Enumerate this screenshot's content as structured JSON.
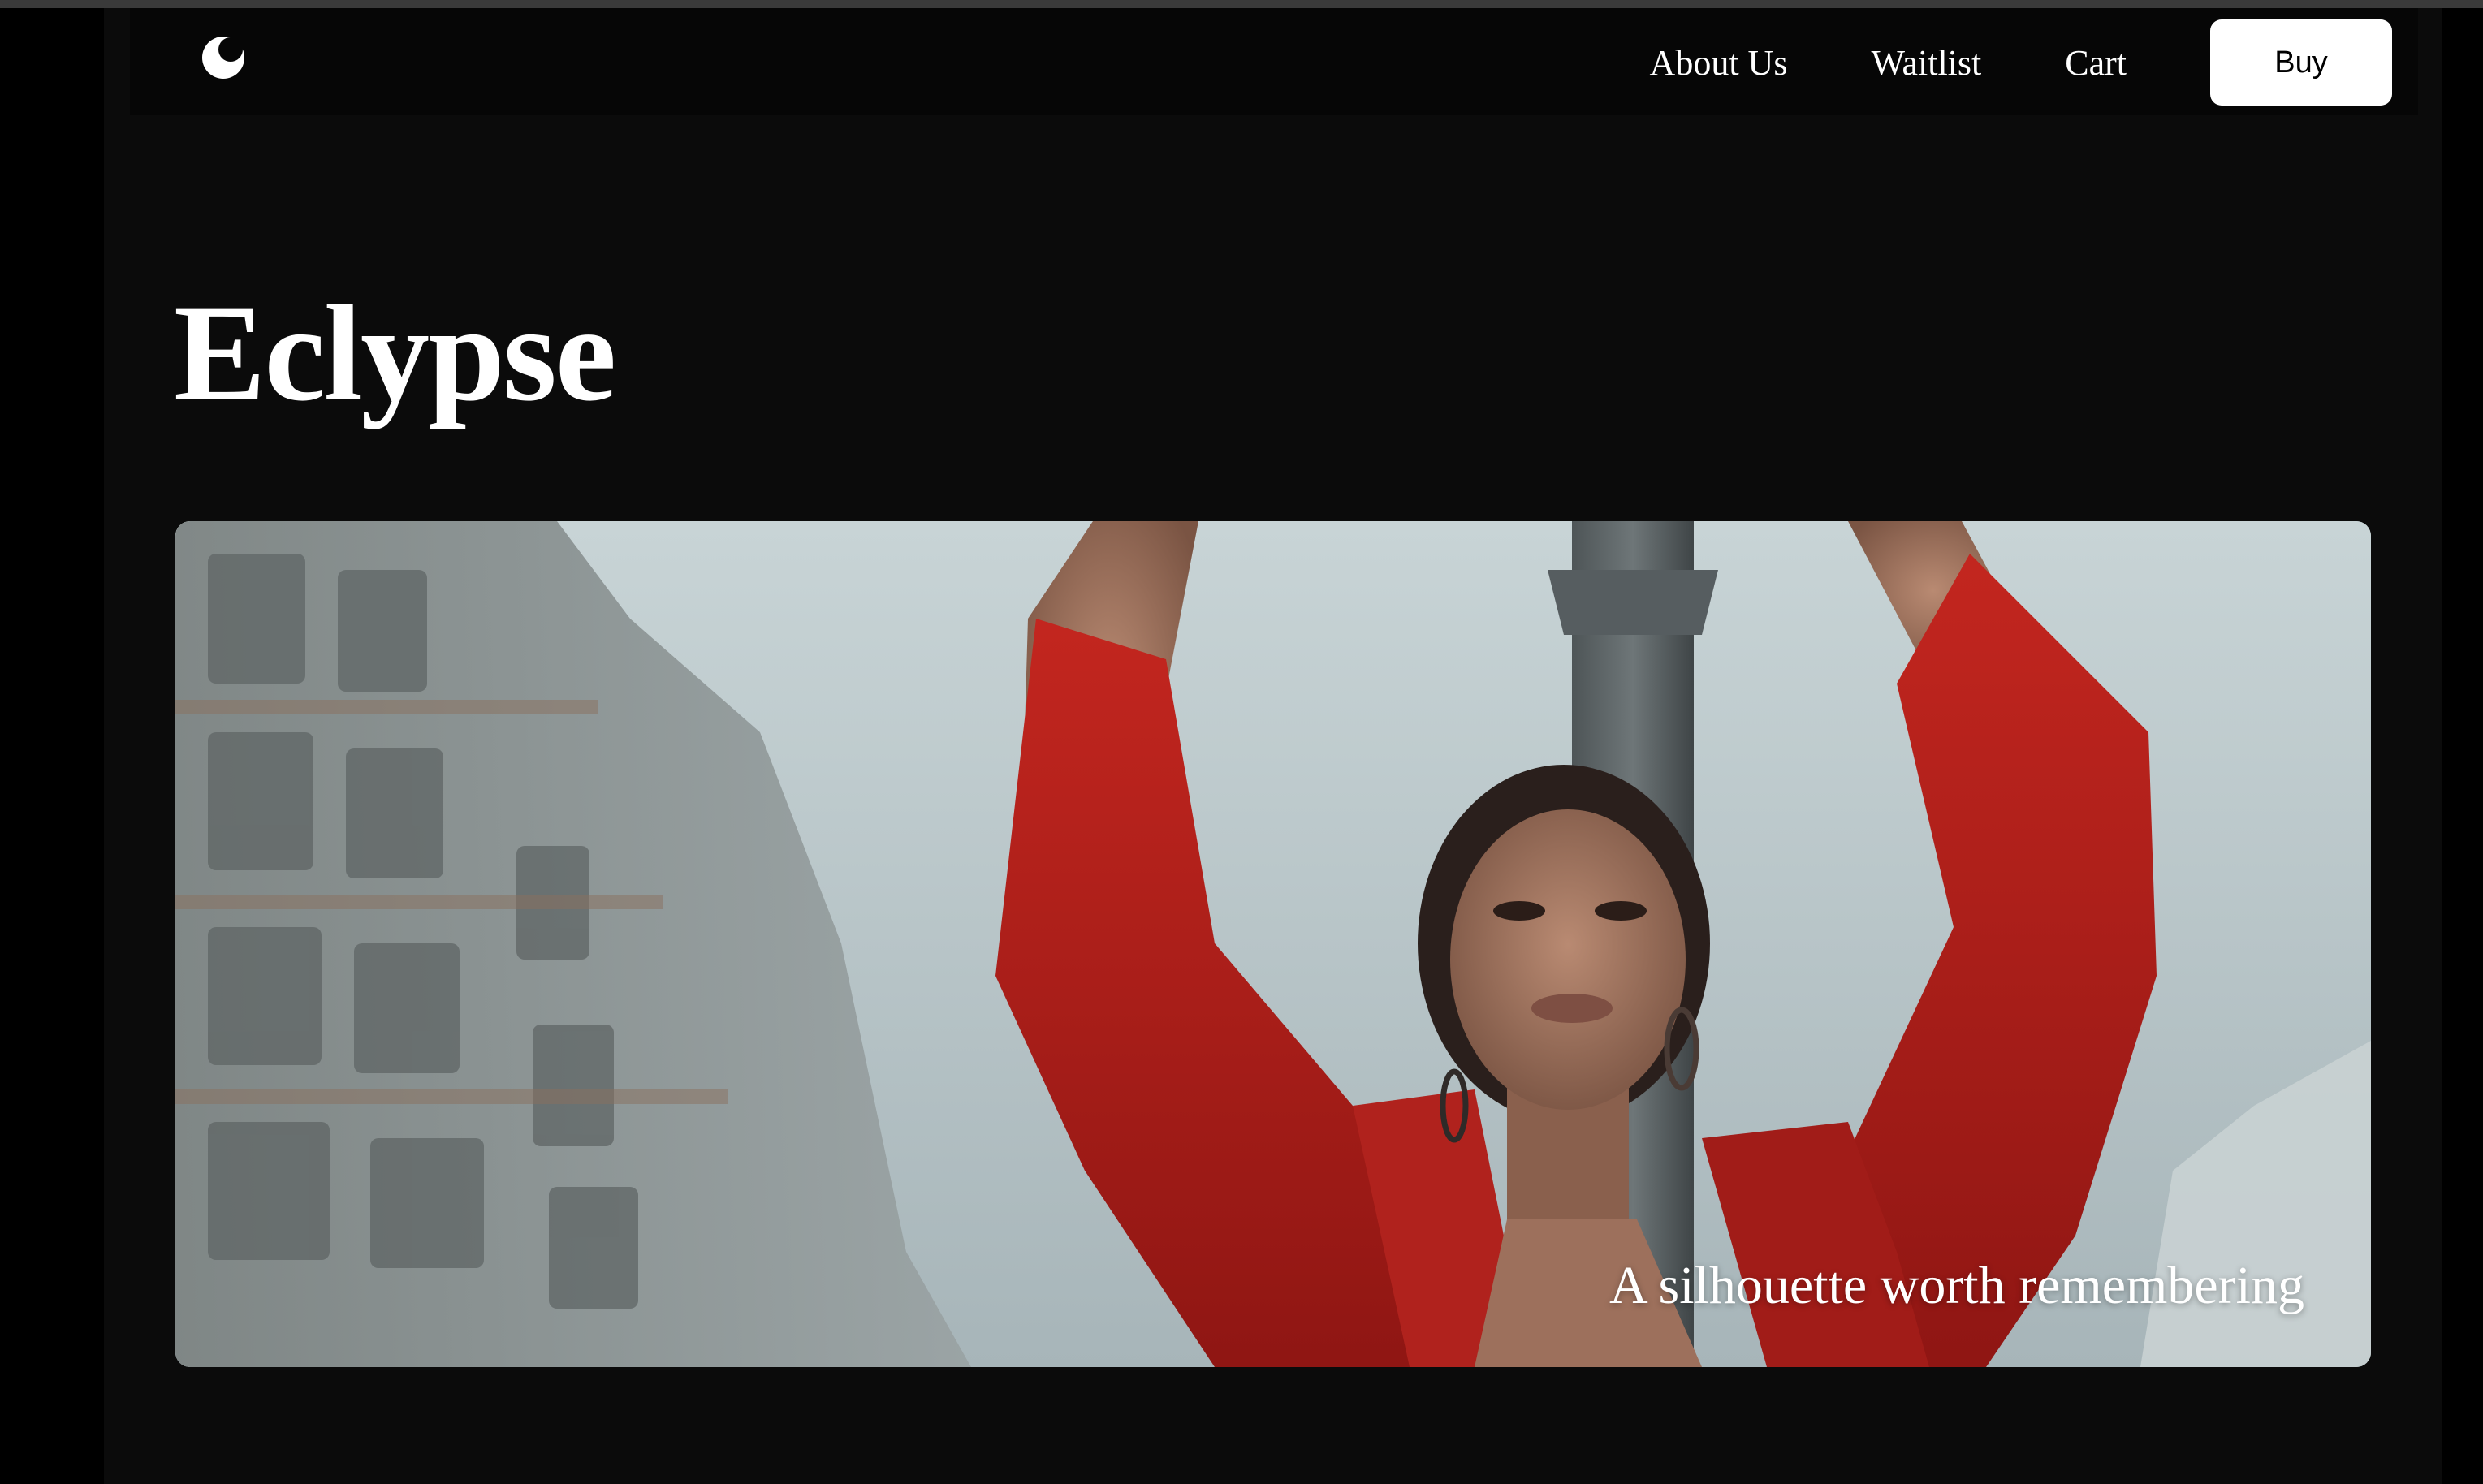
{
  "brand": {
    "logo_icon": "eclipse-logo-icon",
    "title": "Eclypse"
  },
  "nav": {
    "links": [
      {
        "label": "About Us"
      },
      {
        "label": "Waitlist"
      },
      {
        "label": "Cart"
      }
    ],
    "buy_label": "Buy"
  },
  "hero": {
    "caption": "A silhouette worth remembering",
    "image_subject": "woman in red blazer with raised arms in front of buildings and a street lamp"
  },
  "colors": {
    "background": "#0b0b0b",
    "navbar": "#060606",
    "text": "#ffffff",
    "button_bg": "#ffffff",
    "button_text": "#000000",
    "jacket_red": "#b3201c"
  }
}
